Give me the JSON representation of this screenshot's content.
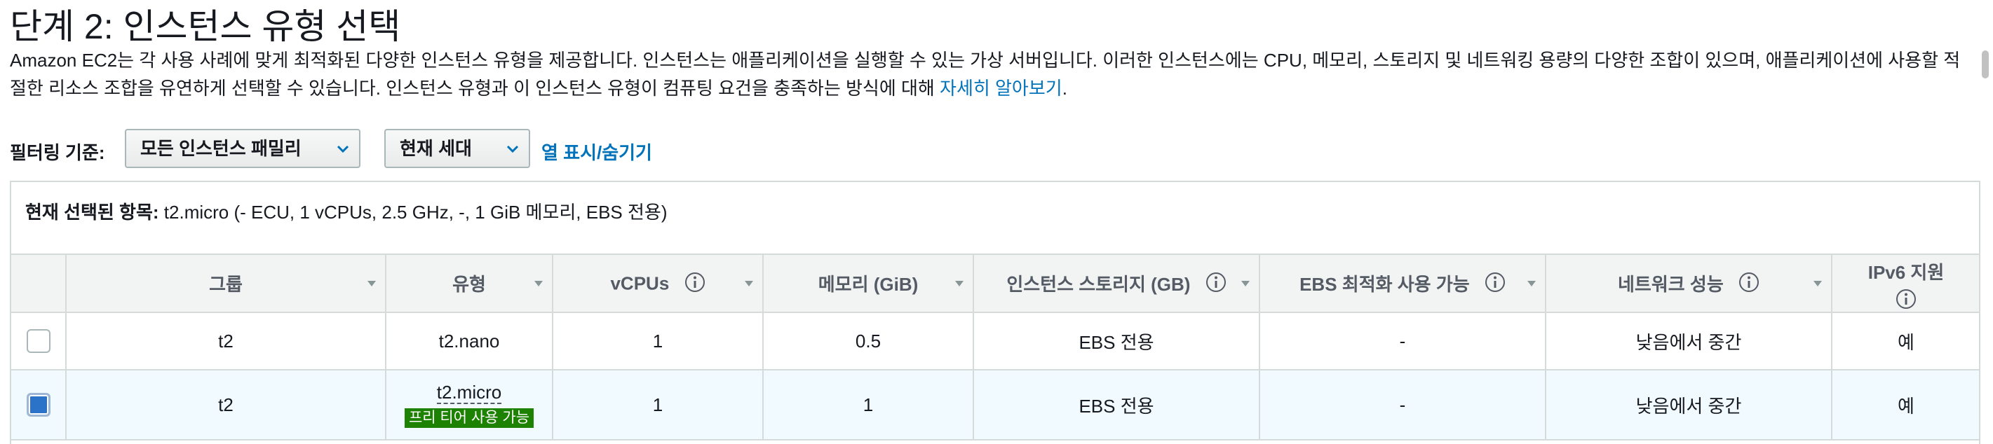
{
  "page": {
    "title": "단계 2: 인스턴스 유형 선택",
    "description_text": "Amazon EC2는 각 사용 사례에 맞게 최적화된 다양한 인스턴스 유형을 제공합니다. 인스턴스는 애플리케이션을 실행할 수 있는 가상 서버입니다. 이러한 인스턴스에는 CPU, 메모리, 스토리지 및 네트워킹 용량의 다양한 조합이 있으며, 애플리케이션에 사용할 적절한 리소스 조합을 유연하게 선택할 수 있습니다. 인스턴스 유형과 이 인스턴스 유형이 컴퓨팅 요건을 충족하는 방식에 대해 ",
    "learn_more_link": "자세히 알아보기",
    "description_end": "."
  },
  "filters": {
    "label": "필터링 기준:",
    "family_select": "모든 인스턴스 패밀리",
    "generation_select": "현재 세대",
    "columns_toggle": "열 표시/숨기기"
  },
  "selection": {
    "label": "현재 선택된 항목:",
    "value": "t2.micro (- ECU, 1 vCPUs, 2.5 GHz, -, 1 GiB 메모리, EBS 전용)"
  },
  "table": {
    "headers": {
      "group": "그룹",
      "type": "유형",
      "vcpus": "vCPUs",
      "memory": "메모리 (GiB)",
      "storage": "인스턴스 스토리지 (GB)",
      "ebs": "EBS 최적화 사용 가능",
      "network": "네트워크 성능",
      "ipv6": "IPv6 지원"
    },
    "rows": [
      {
        "group": "t2",
        "type": "t2.nano",
        "badge": "",
        "vcpus": "1",
        "memory": "0.5",
        "storage": "EBS 전용",
        "ebs": "-",
        "network": "낮음에서 중간",
        "ipv6": "예",
        "selected": false
      },
      {
        "group": "t2",
        "type": "t2.micro",
        "badge": "프리 티어 사용 가능",
        "vcpus": "1",
        "memory": "1",
        "storage": "EBS 전용",
        "ebs": "-",
        "network": "낮음에서 중간",
        "ipv6": "예",
        "selected": true
      }
    ]
  },
  "colors": {
    "link": "#0073bb",
    "badge": "#1d8102",
    "selected_row": "#f1faff",
    "header_bg": "#f2f3f3",
    "checkbox_checked": "#2a73c9"
  },
  "icons": [
    "chevron-down-icon",
    "sort-caret-icon",
    "info-icon"
  ]
}
